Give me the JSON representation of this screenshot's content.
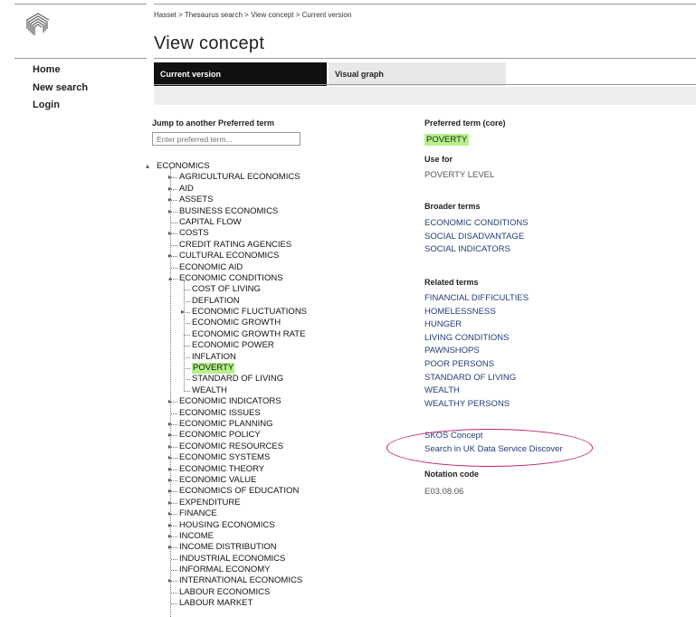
{
  "sidebar": {
    "nav_items": [
      "Home",
      "New search",
      "Login"
    ]
  },
  "breadcrumb": {
    "items": [
      "Hasset",
      "Thesaurus search",
      "View concept",
      "Current version"
    ],
    "separator": ">"
  },
  "page_title": "View concept",
  "tabs": {
    "current": "Current version",
    "visual": "Visual graph"
  },
  "jump": {
    "label": "Jump to another Preferred term",
    "placeholder": "Enter preferred term..."
  },
  "tree": {
    "root": "ECONOMICS",
    "children": [
      "AGRICULTURAL ECONOMICS",
      "AID",
      "ASSETS",
      "BUSINESS ECONOMICS",
      "CAPITAL FLOW",
      "COSTS",
      "CREDIT RATING AGENCIES",
      "CULTURAL ECONOMICS",
      "ECONOMIC AID",
      "ECONOMIC CONDITIONS"
    ],
    "conditions_children": [
      "COST OF LIVING",
      "DEFLATION",
      "ECONOMIC FLUCTUATIONS",
      "ECONOMIC GROWTH",
      "ECONOMIC GROWTH RATE",
      "ECONOMIC POWER",
      "INFLATION",
      "POVERTY",
      "STANDARD OF LIVING",
      "WEALTH"
    ],
    "after": [
      "ECONOMIC INDICATORS",
      "ECONOMIC ISSUES",
      "ECONOMIC PLANNING",
      "ECONOMIC POLICY",
      "ECONOMIC RESOURCES",
      "ECONOMIC SYSTEMS",
      "ECONOMIC THEORY",
      "ECONOMIC VALUE",
      "ECONOMICS OF EDUCATION",
      "EXPENDITURE",
      "FINANCE",
      "HOUSING ECONOMICS",
      "INCOME",
      "INCOME DISTRIBUTION",
      "INDUSTRIAL ECONOMICS",
      "INFORMAL ECONOMY",
      "INTERNATIONAL ECONOMICS",
      "LABOUR ECONOMICS",
      "LABOUR MARKET"
    ]
  },
  "concept": {
    "preferred_label": "Preferred term (core)",
    "preferred_value": "POVERTY",
    "use_for_label": "Use for",
    "use_for": [
      "POVERTY LEVEL"
    ],
    "broader_label": "Broader terms",
    "broader": [
      "ECONOMIC CONDITIONS",
      "SOCIAL DISADVANTAGE",
      "SOCIAL INDICATORS"
    ],
    "related_label": "Related terms",
    "related": [
      "FINANCIAL DIFFICULTIES",
      "HOMELESSNESS",
      "HUNGER",
      "LIVING CONDITIONS",
      "PAWNSHOPS",
      "POOR PERSONS",
      "STANDARD OF LIVING",
      "WEALTH",
      "WEALTHY PERSONS"
    ],
    "skos_link": "SKOS Concept",
    "discover_link": "Search in UK Data Service Discover",
    "notation_label": "Notation code",
    "notation_value": "E03.08.06"
  },
  "colors": {
    "highlight": "#b5f08a",
    "link": "#223c78",
    "annotation": "#c0266e",
    "active_tab": "#111111"
  }
}
